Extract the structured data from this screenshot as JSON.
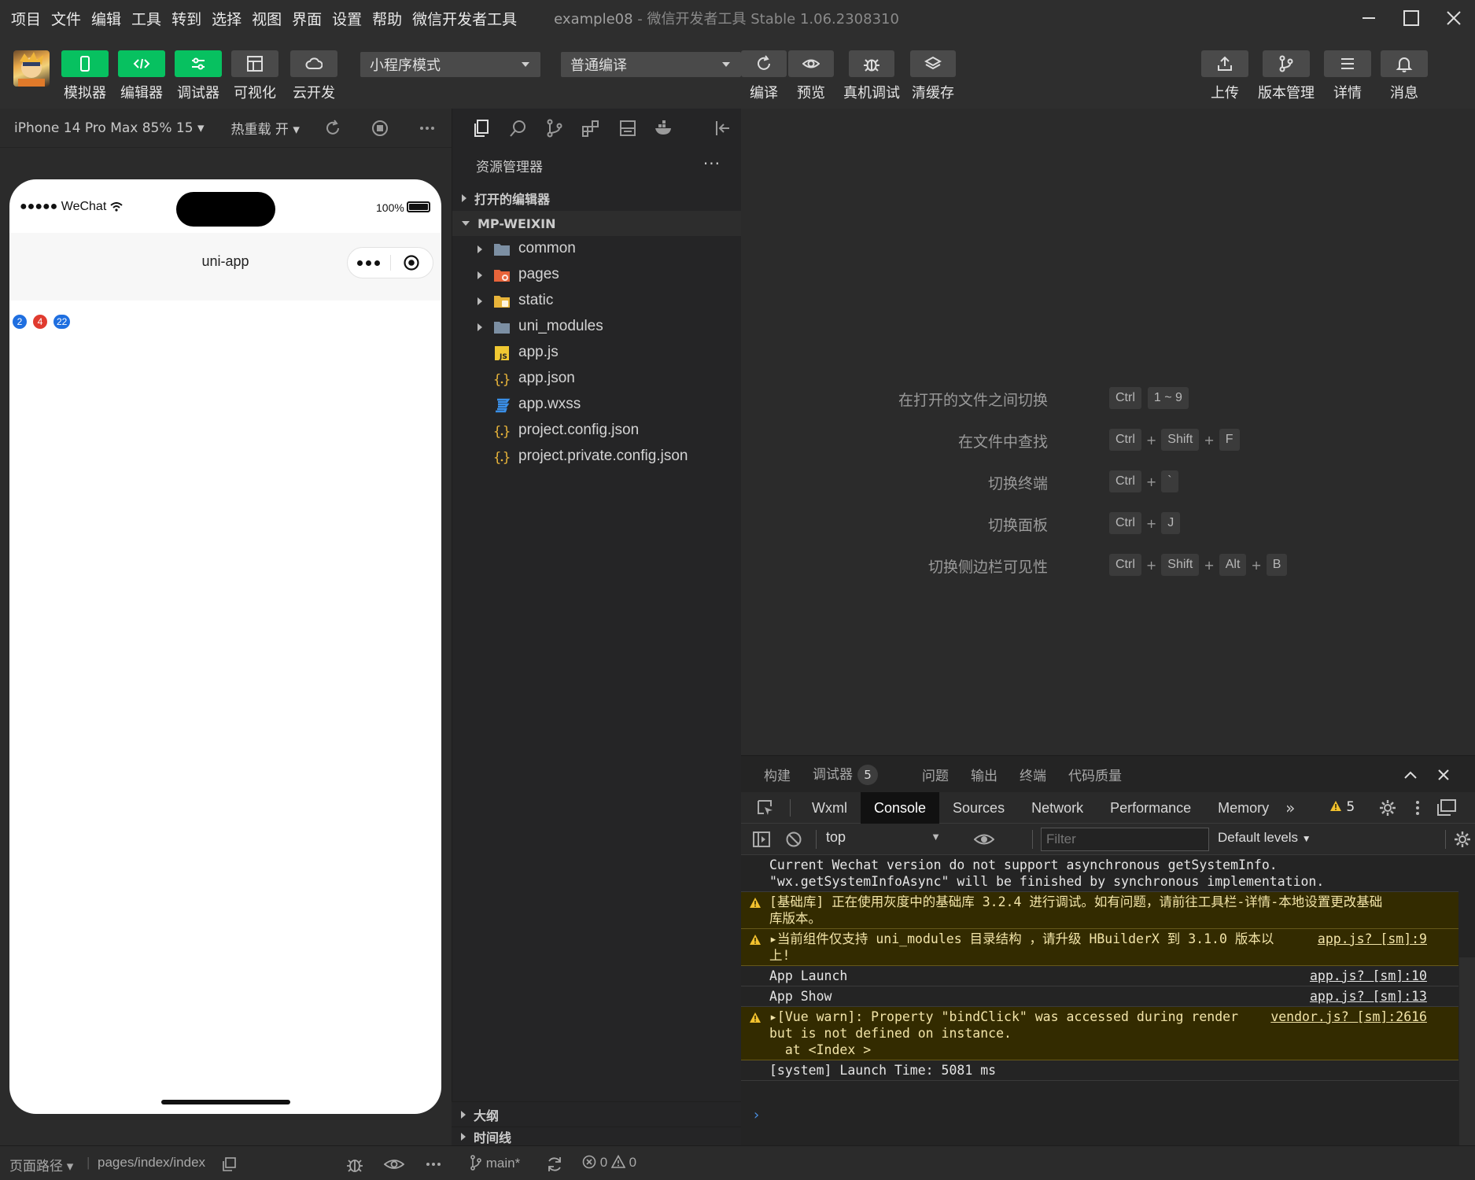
{
  "menu": [
    "项目",
    "文件",
    "编辑",
    "工具",
    "转到",
    "选择",
    "视图",
    "界面",
    "设置",
    "帮助",
    "微信开发者工具"
  ],
  "window": {
    "project": "example08",
    "separator": " - ",
    "app": "微信开发者工具 Stable 1.06.2308310"
  },
  "toolbar": {
    "left_buttons": [
      {
        "label": "模拟器",
        "icon": "phone-icon",
        "active": true
      },
      {
        "label": "编辑器",
        "icon": "code-icon",
        "active": true
      },
      {
        "label": "调试器",
        "icon": "sliders-icon",
        "active": true
      },
      {
        "label": "可视化",
        "icon": "layout-icon",
        "active": false
      },
      {
        "label": "云开发",
        "icon": "cloud-icon",
        "active": false
      }
    ],
    "mode_select": "小程序模式",
    "compile_select": "普通编译",
    "mid_buttons": [
      {
        "label": "编译",
        "icon": "refresh-icon"
      },
      {
        "label": "预览",
        "icon": "eye-icon"
      },
      {
        "label": "真机调试",
        "icon": "bug-icon"
      },
      {
        "label": "清缓存",
        "icon": "layers-icon"
      }
    ],
    "right_buttons": [
      {
        "label": "上传",
        "icon": "upload-icon"
      },
      {
        "label": "版本管理",
        "icon": "branch-icon"
      },
      {
        "label": "详情",
        "icon": "menu-icon"
      },
      {
        "label": "消息",
        "icon": "bell-icon"
      }
    ]
  },
  "simulator": {
    "device": "iPhone 14 Pro Max 85% 15",
    "hot_reload": "热重载 开",
    "status_left": "●●●●● WeChat",
    "battery": "100%",
    "nav_title": "uni-app",
    "badges": [
      {
        "text": "2",
        "color": "#1f6fe0"
      },
      {
        "text": "4",
        "color": "#e03b2f"
      },
      {
        "text": "22",
        "color": "#1f6fe0"
      }
    ]
  },
  "explorer": {
    "title": "资源管理器",
    "more": "···",
    "open_editors": "打开的编辑器",
    "root": "MP-WEIXIN",
    "items": [
      {
        "name": "common",
        "type": "folder",
        "icon": "folder-icon",
        "color": "#7c8fa3"
      },
      {
        "name": "pages",
        "type": "folder",
        "icon": "pages-folder-icon",
        "color": "#e8643a"
      },
      {
        "name": "static",
        "type": "folder",
        "icon": "static-folder-icon",
        "color": "#e8b43a"
      },
      {
        "name": "uni_modules",
        "type": "folder",
        "icon": "folder-icon",
        "color": "#7c8fa3"
      },
      {
        "name": "app.js",
        "type": "file",
        "icon": "js-file-icon",
        "color": "#f0c832"
      },
      {
        "name": "app.json",
        "type": "file",
        "icon": "json-file-icon",
        "color": "#e8b43a"
      },
      {
        "name": "app.wxss",
        "type": "file",
        "icon": "css-file-icon",
        "color": "#3a8fe8"
      },
      {
        "name": "project.config.json",
        "type": "file",
        "icon": "json-file-icon",
        "color": "#e8b43a"
      },
      {
        "name": "project.private.config.json",
        "type": "file",
        "icon": "json-file-icon",
        "color": "#e8b43a"
      }
    ],
    "outline": "大纲",
    "timeline": "时间线"
  },
  "shortcuts": [
    {
      "desc": "在打开的文件之间切换",
      "keys": [
        "Ctrl",
        "1 ~ 9"
      ],
      "joined": false
    },
    {
      "desc": "在文件中查找",
      "keys": [
        "Ctrl",
        "Shift",
        "F"
      ],
      "joined": true
    },
    {
      "desc": "切换终端",
      "keys": [
        "Ctrl",
        "`"
      ],
      "joined": true
    },
    {
      "desc": "切换面板",
      "keys": [
        "Ctrl",
        "J"
      ],
      "joined": true
    },
    {
      "desc": "切换侧边栏可见性",
      "keys": [
        "Ctrl",
        "Shift",
        "Alt",
        "B"
      ],
      "joined": true
    }
  ],
  "panel": {
    "tabs": [
      "构建",
      "调试器",
      "问题",
      "输出",
      "终端",
      "代码质量"
    ],
    "active_tab": "调试器",
    "debugger_count": "5",
    "devtools_tabs": [
      "Wxml",
      "Console",
      "Sources",
      "Network",
      "Performance",
      "Memory"
    ],
    "active_devtools_tab": "Console",
    "more_tabs": "»",
    "warn_count": "5",
    "context": "top",
    "filter_placeholder": "Filter",
    "levels": "Default levels",
    "prompt": "›",
    "logs": [
      {
        "level": "info",
        "text": "Current Wechat version do not support asynchronous getSystemInfo.\n\"wx.getSystemInfoAsync\" will be finished by synchronous implementation.",
        "source": ""
      },
      {
        "level": "warn",
        "text": "[基础库] 正在使用灰度中的基础库 3.2.4 进行调试。如有问题，请前往工具栏-详情-本地设置更改基础\n库版本。",
        "source": ""
      },
      {
        "level": "warn",
        "text": "▸当前组件仅支持 uni_modules 目录结构 ，请升级 HBuilderX 到 3.1.0 版本以\n上!",
        "source": "app.js? [sm]:9"
      },
      {
        "level": "info",
        "text": "App Launch",
        "source": "app.js? [sm]:10"
      },
      {
        "level": "info",
        "text": "App Show",
        "source": "app.js? [sm]:13"
      },
      {
        "level": "warn",
        "text": "▸[Vue warn]: Property \"bindClick\" was accessed during render\nbut is not defined on instance.\n  at <Index >",
        "source": "vendor.js? [sm]:2616"
      },
      {
        "level": "info",
        "text": "[system] Launch Time: 5081 ms",
        "source": ""
      }
    ]
  },
  "statusbar": {
    "page_path_label": "页面路径",
    "page_path": "pages/index/index",
    "branch": "main*",
    "errors": "0",
    "warnings": "0"
  }
}
